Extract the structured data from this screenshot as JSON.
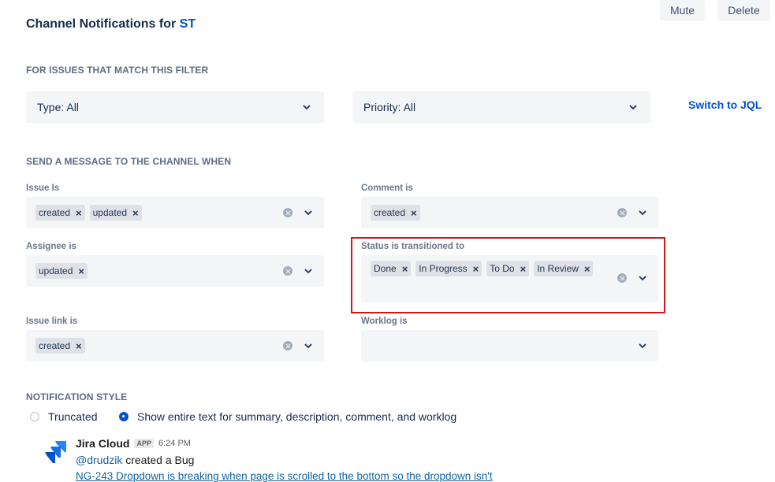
{
  "header": {
    "title_prefix": "Channel Notifications for",
    "project_key": "ST",
    "mute_label": "Mute",
    "delete_label": "Delete"
  },
  "filter": {
    "section_title": "FOR ISSUES THAT MATCH THIS FILTER",
    "type_select": "Type: All",
    "priority_select": "Priority: All",
    "switch_jql": "Switch to JQL"
  },
  "triggers": {
    "section_title": "SEND A MESSAGE TO THE CHANNEL WHEN",
    "issue_is": {
      "label": "Issue Is",
      "tags": [
        "created",
        "updated"
      ]
    },
    "comment_is": {
      "label": "Comment is",
      "tags": [
        "created"
      ]
    },
    "assignee_is": {
      "label": "Assignee is",
      "tags": [
        "updated"
      ]
    },
    "status_transitioned": {
      "label": "Status is transitioned to",
      "tags": [
        "Done",
        "In Progress",
        "To Do",
        "In Review"
      ]
    },
    "issue_link_is": {
      "label": "Issue link is",
      "tags": [
        "created"
      ]
    },
    "worklog_is": {
      "label": "Worklog is",
      "tags": []
    }
  },
  "style": {
    "section_title": "NOTIFICATION STYLE",
    "option_truncated": "Truncated",
    "option_full": "Show entire text for summary, description, comment, and worklog",
    "selected": "full"
  },
  "preview": {
    "app_name": "Jira Cloud",
    "app_badge": "APP",
    "time": "6:24 PM",
    "mention": "@drudzik",
    "action": " created a Bug",
    "issue_link": "NG-243 Dropdown is breaking when page is scrolled to the bottom so the dropdown isn't"
  },
  "colors": {
    "accent": "#0052cc",
    "highlight_border": "#cc1a1a",
    "field_bg": "#f4f5f7"
  }
}
